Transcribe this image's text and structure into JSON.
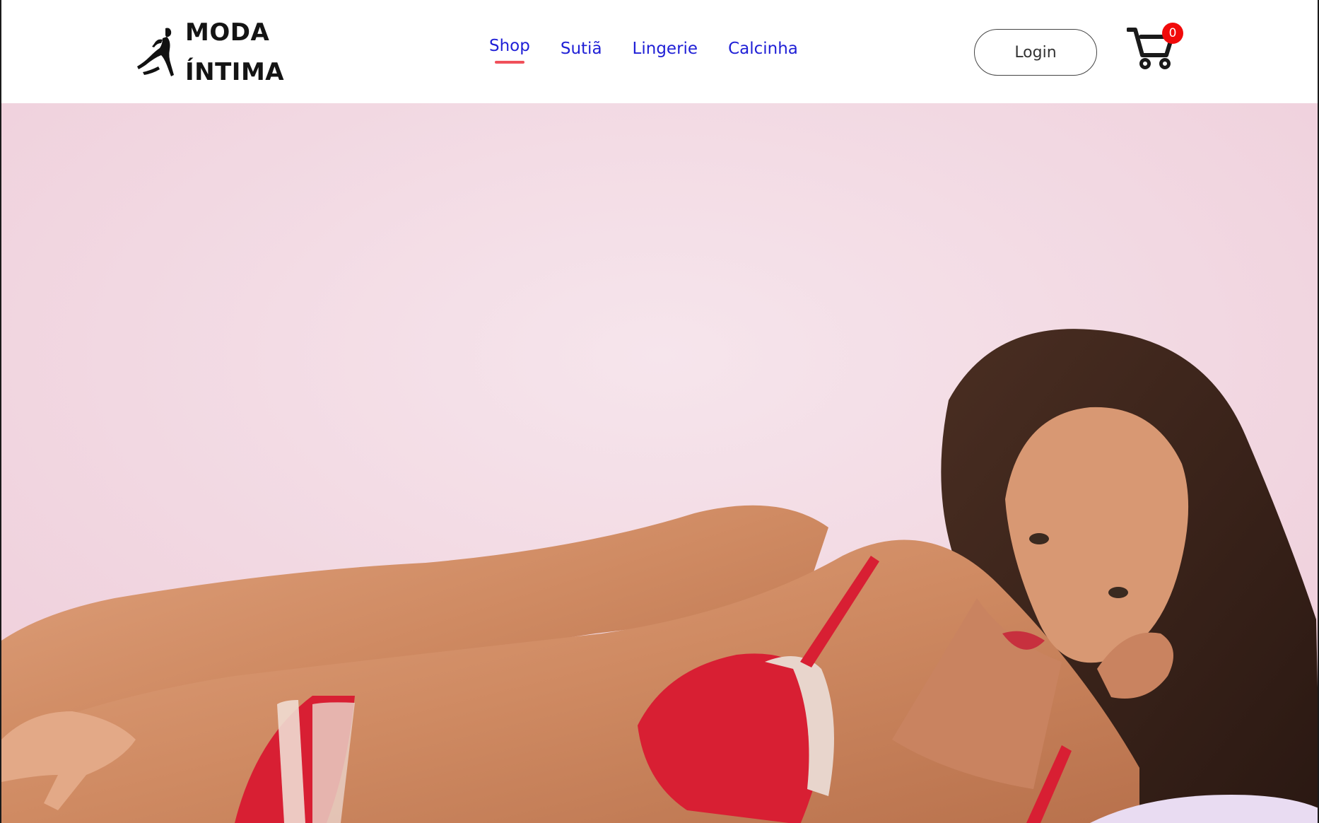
{
  "brand": {
    "line1": "MODA",
    "line2": "ÍNTIMA",
    "logo_icon": "woman-silhouette-icon"
  },
  "nav": {
    "items": [
      {
        "label": "Shop",
        "active": true
      },
      {
        "label": "Sutiã",
        "active": false
      },
      {
        "label": "Lingerie",
        "active": false
      },
      {
        "label": "Calcinha",
        "active": false
      }
    ],
    "link_color": "#1f1fd6",
    "active_underline_color": "#f0505a"
  },
  "account": {
    "login_label": "Login"
  },
  "cart": {
    "icon": "shopping-cart-icon",
    "count": "0",
    "badge_color": "#f10a0a"
  },
  "hero": {
    "image": "lingerie-model-hero-photo",
    "background_color": "#f3dfe7",
    "lingerie_color": "#d81f33"
  }
}
